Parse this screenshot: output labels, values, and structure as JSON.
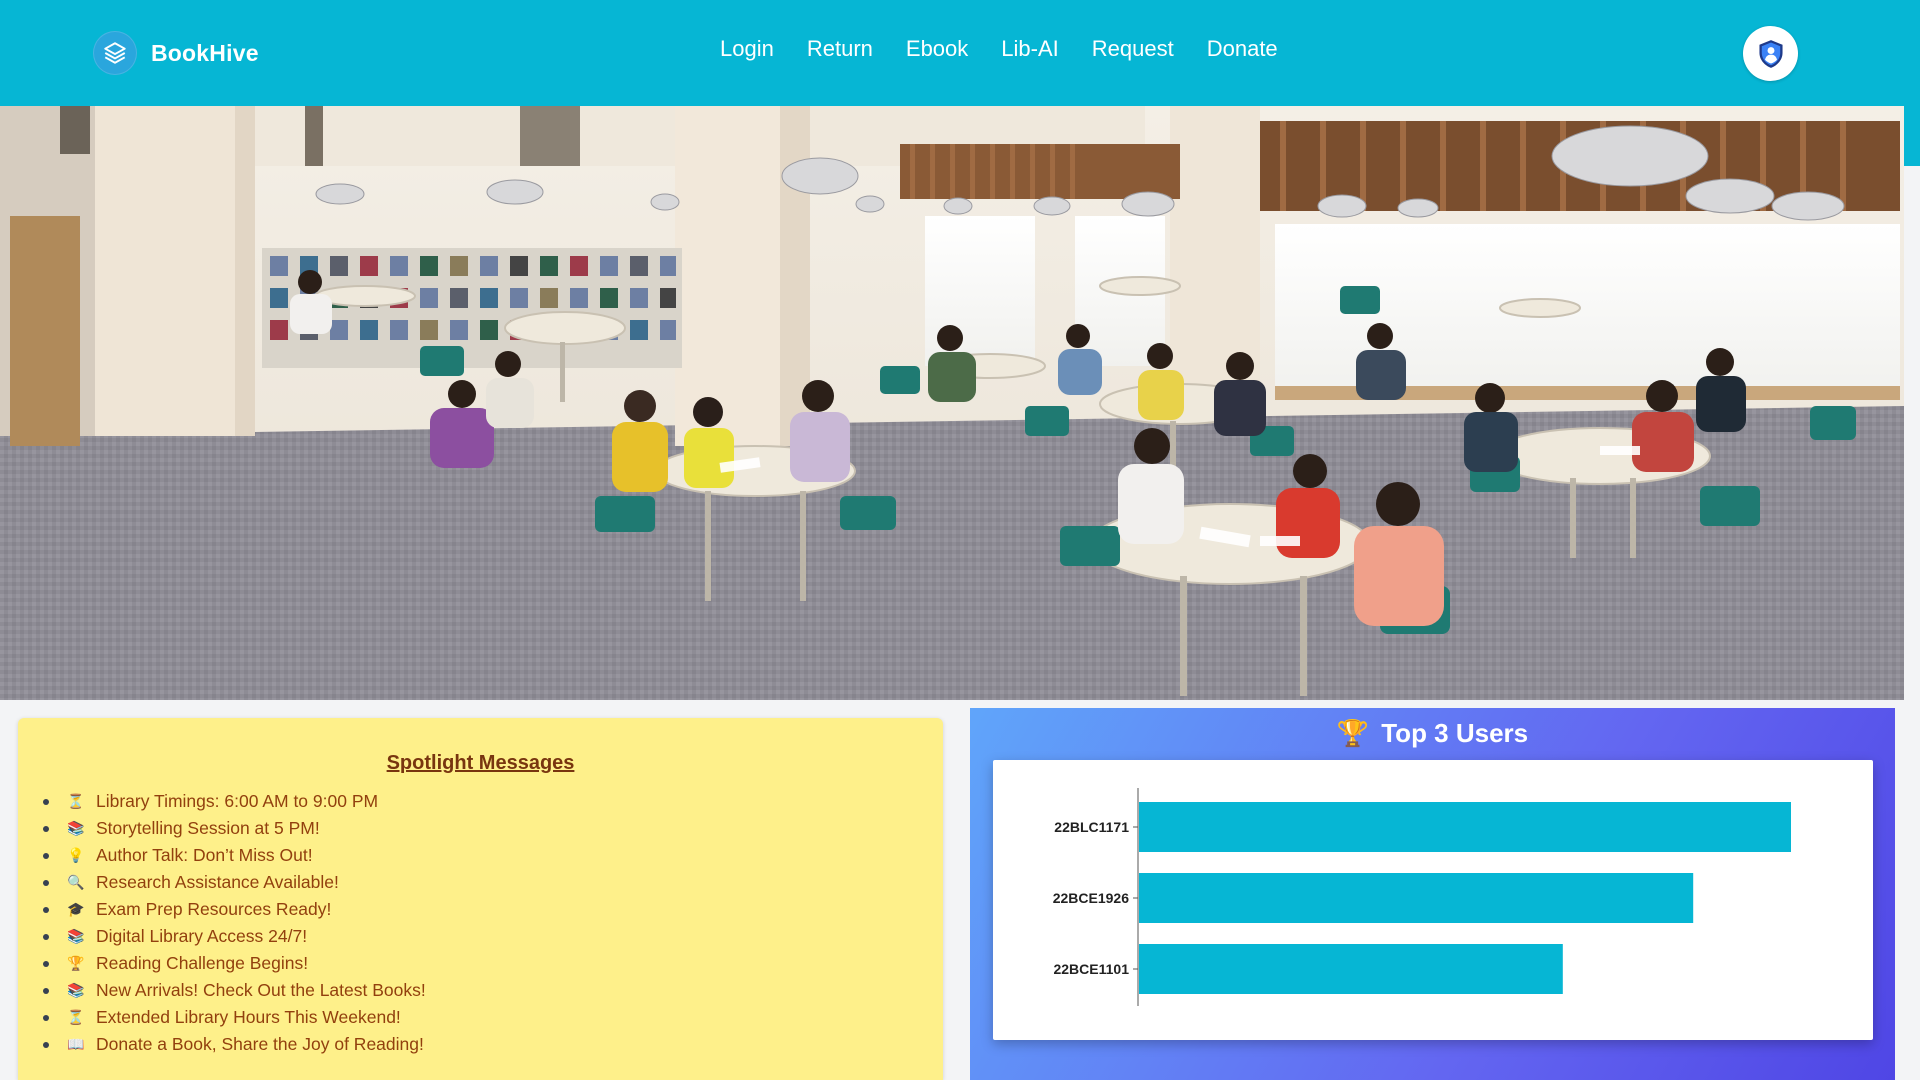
{
  "brand": {
    "name": "BookHive"
  },
  "nav": {
    "links": [
      "Login",
      "Return",
      "Ebook",
      "Lib-AI",
      "Request",
      "Donate"
    ]
  },
  "spotlight": {
    "title": "Spotlight Messages",
    "items": [
      {
        "icon": "hourglass-icon",
        "text": "Library Timings: 6:00 AM to 9:00 PM"
      },
      {
        "icon": "books-icon",
        "text": "Storytelling Session at 5 PM!"
      },
      {
        "icon": "lightbulb-icon",
        "text": "Author Talk: Don’t Miss Out!"
      },
      {
        "icon": "magnifier-icon",
        "text": "Research Assistance Available!"
      },
      {
        "icon": "graduation-cap-icon",
        "text": "Exam Prep Resources Ready!"
      },
      {
        "icon": "books-icon",
        "text": "Digital Library Access 24/7!"
      },
      {
        "icon": "trophy-icon",
        "text": "Reading Challenge Begins!"
      },
      {
        "icon": "books-icon",
        "text": "New Arrivals! Check Out the Latest Books!"
      },
      {
        "icon": "hourglass-icon",
        "text": "Extended Library Hours This Weekend!"
      },
      {
        "icon": "open-book-icon",
        "text": "Donate a Book, Share the Joy of Reading!"
      }
    ]
  },
  "top_users": {
    "title": "Top 3 Users",
    "icon": "trophy-icon"
  },
  "chart_data": {
    "type": "bar",
    "orientation": "horizontal",
    "categories": [
      "22BLC1171",
      "22BCE1926",
      "22BCE1101"
    ],
    "values": [
      100,
      85,
      65
    ],
    "title": "",
    "xlabel": "",
    "ylabel": "",
    "grid": false,
    "bar_color": "#06b6d4"
  }
}
